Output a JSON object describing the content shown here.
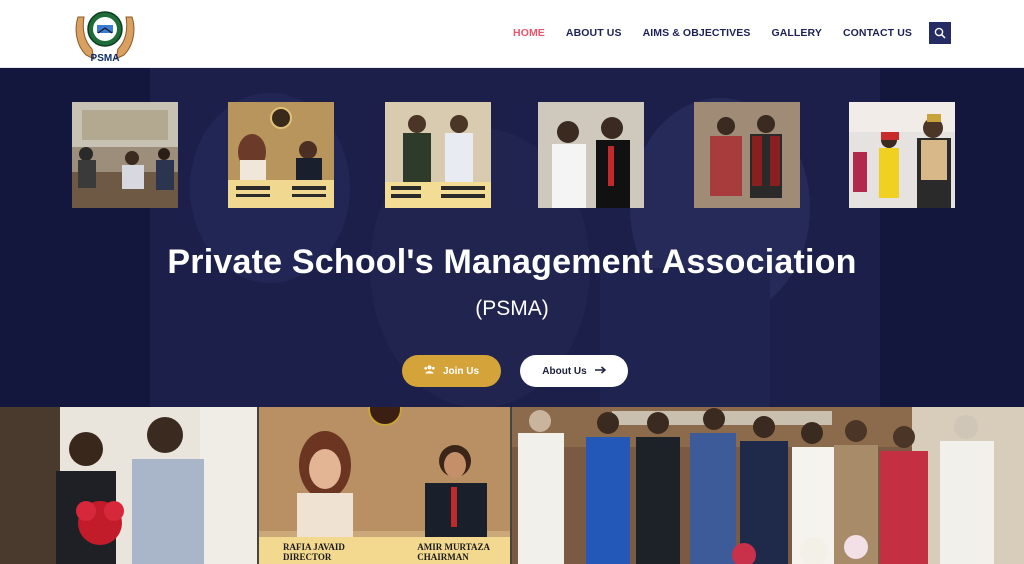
{
  "header": {
    "logo_text": "PSMA",
    "nav": [
      {
        "label": "HOME",
        "active": true
      },
      {
        "label": "ABOUT US",
        "active": false
      },
      {
        "label": "AIMS & OBJECTIVES",
        "active": false
      },
      {
        "label": "GALLERY",
        "active": false
      },
      {
        "label": "CONTACT US",
        "active": false
      }
    ],
    "search_icon": "search-icon"
  },
  "hero": {
    "title": "Private School's Management Association",
    "subtitle": "(PSMA)",
    "join_button": {
      "label": "Join Us",
      "icon": "users-icon"
    },
    "about_button": {
      "label": "About Us",
      "icon": "arrow-right-icon"
    }
  },
  "strip": {
    "photos": [
      {
        "caption_left": "",
        "caption_right": ""
      },
      {
        "caption_left": "RAFIA JAVAID",
        "caption_left_2": "DIRECTOR",
        "caption_right": "AMIR MURTAZA",
        "caption_right_2": "CHAIRMAN"
      },
      {
        "caption_left": "",
        "caption_right": ""
      }
    ]
  },
  "colors": {
    "hero_bg": "#13163d",
    "nav_text": "#1d2156",
    "nav_active": "#e8546b",
    "join_button": "#d4a43a",
    "search_button": "#252b63"
  }
}
